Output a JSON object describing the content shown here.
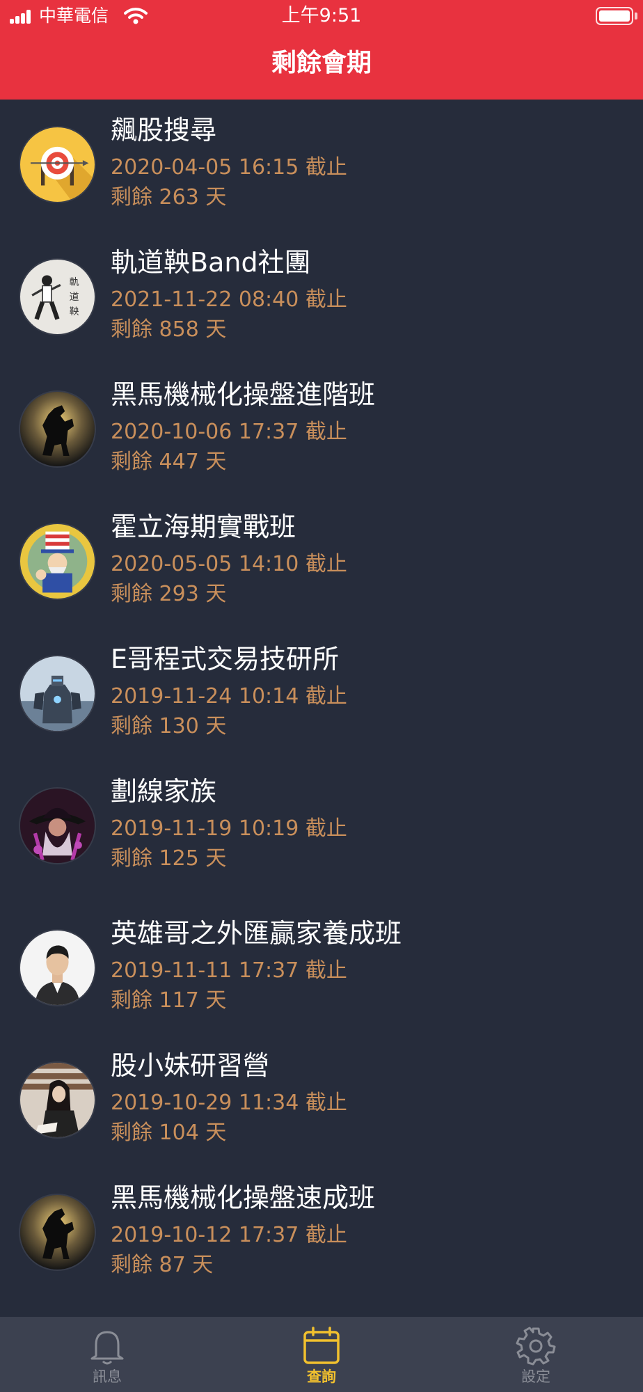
{
  "status_bar": {
    "carrier": "中華電信",
    "time": "上午9:51"
  },
  "nav": {
    "title": "剩餘會期"
  },
  "items": [
    {
      "title": "飆股搜尋",
      "expiry": "2020-04-05 16:15 截止",
      "remaining": "剩餘 263 天",
      "avatar": "target-avatar"
    },
    {
      "title": "軌道鞅Band社團",
      "expiry": "2021-11-22 08:40 截止",
      "remaining": "剩餘 858 天",
      "avatar": "martial-artist-avatar"
    },
    {
      "title": "黑馬機械化操盤進階班",
      "expiry": "2020-10-06 17:37 截止",
      "remaining": "剩餘 447 天",
      "avatar": "black-horse-avatar"
    },
    {
      "title": "霍立海期實戰班",
      "expiry": "2020-05-05 14:10 截止",
      "remaining": "剩餘 293 天",
      "avatar": "uncle-sam-avatar"
    },
    {
      "title": "E哥程式交易技研所",
      "expiry": "2019-11-24 10:14 截止",
      "remaining": "剩餘 130 天",
      "avatar": "robot-avatar"
    },
    {
      "title": "劃線家族",
      "expiry": "2019-11-19 10:19 截止",
      "remaining": "剩餘 125 天",
      "avatar": "wizard-avatar"
    },
    {
      "title": "英雄哥之外匯贏家養成班",
      "expiry": "2019-11-11 17:37 截止",
      "remaining": "剩餘 117 天",
      "avatar": "man-portrait-avatar"
    },
    {
      "title": "股小妹研習營",
      "expiry": "2019-10-29 11:34 截止",
      "remaining": "剩餘 104 天",
      "avatar": "woman-reading-avatar"
    },
    {
      "title": "黑馬機械化操盤速成班",
      "expiry": "2019-10-12 17:37 截止",
      "remaining": "剩餘 87 天",
      "avatar": "black-horse-avatar"
    }
  ],
  "tabs": [
    {
      "label": "訊息",
      "icon": "bell-icon",
      "active": false
    },
    {
      "label": "查詢",
      "icon": "calendar-icon",
      "active": true
    },
    {
      "label": "設定",
      "icon": "gear-icon",
      "active": false
    }
  ],
  "colors": {
    "header": "#e8323f",
    "background": "#262c3b",
    "accent_text": "#c98f5b",
    "tab_active": "#f2c12e",
    "tab_inactive": "#8a8d96"
  }
}
